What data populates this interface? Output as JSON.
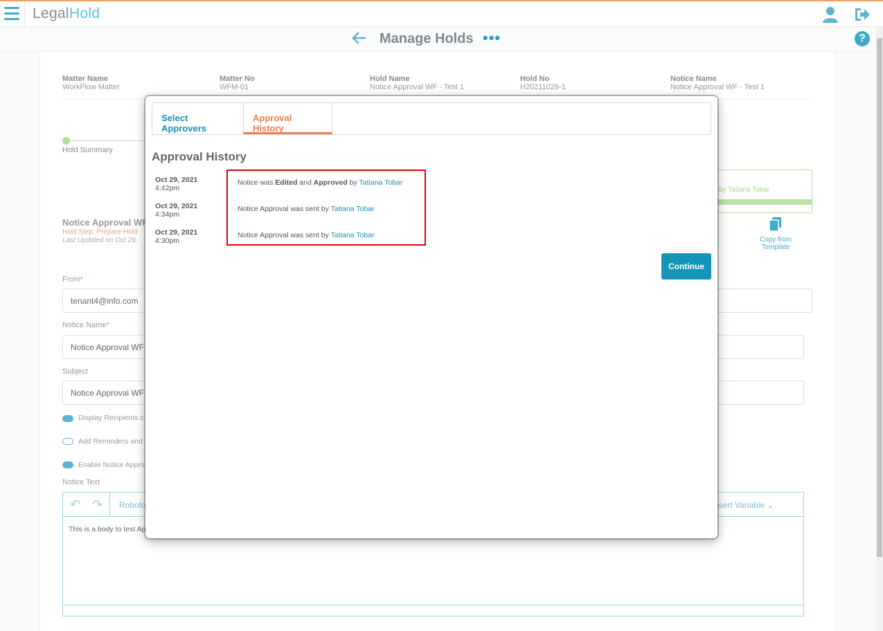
{
  "app": {
    "logo_part1": "Legal",
    "logo_part2": "Hold"
  },
  "header": {
    "title": "Manage Holds",
    "more": "•••",
    "help": "?"
  },
  "info": [
    {
      "label": "Matter Name",
      "value": "WorkFlow Matter"
    },
    {
      "label": "Matter No",
      "value": "WFM-01"
    },
    {
      "label": "Hold Name",
      "value": "Notice Approval WF - Test 1"
    },
    {
      "label": "Hold No",
      "value": "H20211029-1"
    },
    {
      "label": "Notice Name",
      "value": "Notice Approval WF - Test 1"
    }
  ],
  "steps": {
    "first": "Hold Summary"
  },
  "notice": {
    "heading": "Notice Approval WF",
    "hold_step": "Hold Step: Prepare Hold",
    "last_updated": "Last Updated on Oct 29,",
    "status_text": "by Tatiana Tobar",
    "copy_template": "Copy from Template"
  },
  "form": {
    "from_label": "From",
    "from_value": "tenant4@info.com",
    "notice_name_label": "Notice Name",
    "notice_name_value": "Notice Approval WF",
    "subject_label": "Subject",
    "subject_value": "Notice Approval WF",
    "required_mark": "*",
    "toggles": [
      {
        "label": "Display Recipients c",
        "on": true
      },
      {
        "label": "Add Reminders and",
        "on": false
      },
      {
        "label": "Enable Notice Appro",
        "on": true
      }
    ],
    "notice_text_label": "Notice Text",
    "editor_font": "Roboto",
    "insert_variable": "nsert Variable ⌄",
    "editor_body": "This is a body to test Ap"
  },
  "modal": {
    "tabs": [
      {
        "label": "Select Approvers",
        "active": false
      },
      {
        "label": "Approval History",
        "active": true
      }
    ],
    "history_title": "Approval History",
    "history": [
      {
        "date": "Oct 29, 2021",
        "time": "4:42pm",
        "pre": "Notice was ",
        "b1": "Edited",
        "mid": " and ",
        "b2": "Approved",
        "post": " by ",
        "user": "Tatiana Tobar"
      },
      {
        "date": "Oct 29, 2021",
        "time": "4:34pm",
        "pre": "Notice Approval was sent by ",
        "b1": "",
        "mid": "",
        "b2": "",
        "post": "",
        "user": "Tatiana Tobar"
      },
      {
        "date": "Oct 29, 2021",
        "time": "4:30pm",
        "pre": "Notice Approval was sent by ",
        "b1": "",
        "mid": "",
        "b2": "",
        "post": "",
        "user": "Tatiana Tobar"
      }
    ],
    "continue_label": "Continue"
  },
  "colors": {
    "accent": "#1494b8",
    "active_tab": "#ef7d4f",
    "highlight": "#e00000"
  }
}
